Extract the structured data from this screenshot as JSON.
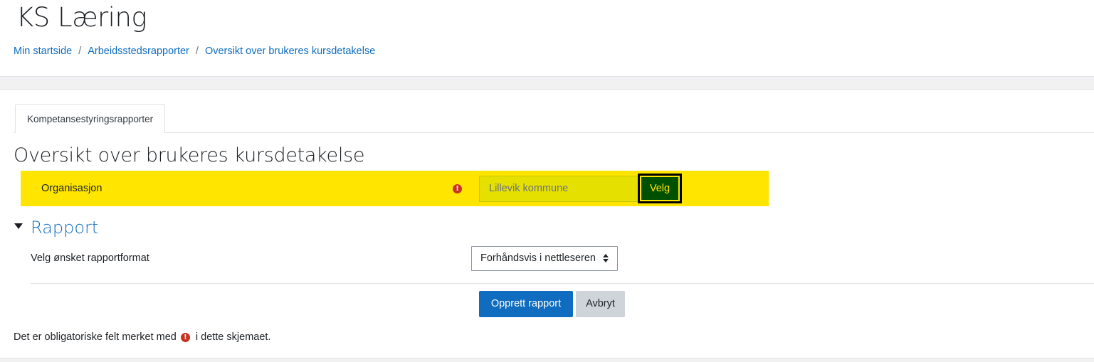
{
  "site": {
    "title": "KS Læring"
  },
  "breadcrumb": {
    "items": [
      "Min startside",
      "Arbeidsstedsrapporter",
      "Oversikt over brukeres kursdetakelse"
    ],
    "separator": "/"
  },
  "tabs": [
    {
      "label": "Kompetansestyringsrapporter",
      "active": true
    }
  ],
  "page": {
    "heading": "Oversikt over brukeres kursdetakelse"
  },
  "organization_field": {
    "label": "Organisasjon",
    "required_icon": "exclamation-circle-icon",
    "value": "Lillevik kommune",
    "button_label": "Velg",
    "highlight_color": "#ffe500"
  },
  "rapport_section": {
    "title": "Rapport",
    "expanded": true,
    "format_label": "Velg ønsket rapportformat",
    "format_selected": "Forhåndsvis i nettleseren"
  },
  "actions": {
    "submit_label": "Opprett rapport",
    "cancel_label": "Avbryt"
  },
  "footnote": {
    "before": "Det er obligatoriske felt merket med",
    "after": "i dette skjemaet."
  },
  "colors": {
    "primary": "#0f6cbf",
    "required": "#ca3120"
  }
}
